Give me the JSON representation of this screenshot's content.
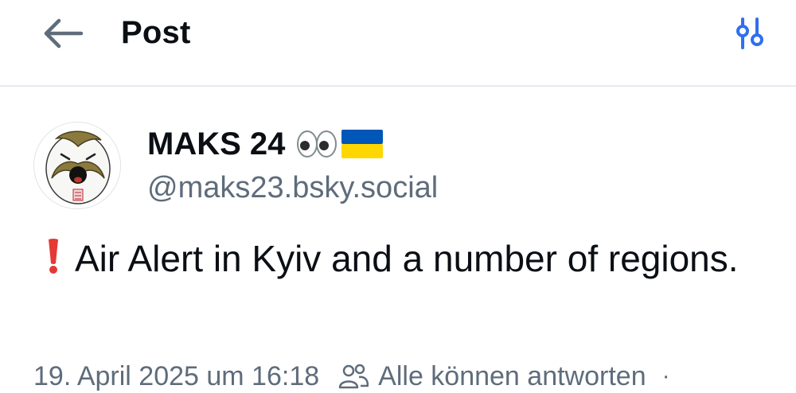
{
  "header": {
    "title": "Post",
    "back_icon": "arrow-left-icon",
    "settings_icon": "sliders-icon"
  },
  "post": {
    "author": {
      "display_name": "MAKS 24",
      "name_emojis": [
        "eyes-emoji",
        "ukraine-flag-emoji"
      ],
      "handle": "@maks23.bsky.social",
      "avatar": "avatar-image"
    },
    "text": "Air Alert in Kyiv and a number of regions.",
    "text_prefix_icon": "red-exclamation-icon",
    "timestamp": "19. April 2025 um 16:18",
    "reply_setting_icon": "people-icon",
    "reply_setting": "Alle können antworten",
    "separator": "·"
  },
  "colors": {
    "accent": "#2f6ff2",
    "text_primary": "#0b0f14",
    "text_secondary": "#5e6c7b",
    "divider": "#e6eaef",
    "flag_blue": "#0057b7",
    "flag_yellow": "#ffd700",
    "exclaim_red": "#e53935"
  }
}
